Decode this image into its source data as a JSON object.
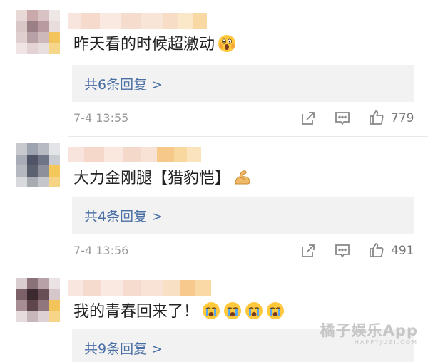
{
  "comments": [
    {
      "text": "昨天看的时候超激动",
      "emoji": [
        "scream-emoji"
      ],
      "replies": "共6条回复 >",
      "time": "7-4 13:55",
      "likes": "779"
    },
    {
      "text": "大力金刚腿【猎豹恺】",
      "emoji": [
        "flexed-biceps-emoji"
      ],
      "replies": "共4条回复 >",
      "time": "7-4 13:56",
      "likes": "491"
    },
    {
      "text": "我的青春回来了！",
      "emoji": [
        "crying-emoji",
        "crying-emoji",
        "crying-emoji",
        "crying-emoji"
      ],
      "replies": "共9条回复 >",
      "time": "",
      "likes": ""
    }
  ],
  "icons": {
    "repost": "share-icon",
    "comment": "comment-icon",
    "like": "thumbs-up-icon"
  },
  "colors": {
    "link": "#4a6fa5",
    "reply_bg": "#f2f2f2",
    "muted": "#999999"
  },
  "watermark": {
    "main": "橘子娱乐App",
    "sub": "HAPPYJUZI.COM"
  }
}
